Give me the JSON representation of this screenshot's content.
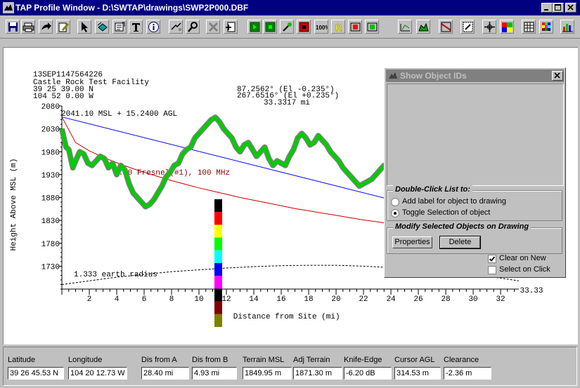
{
  "window": {
    "title": "TAP Profile Window - D:\\SWTAP\\drawings\\SWP2P000.DBF"
  },
  "header": {
    "site_id": "13SEP1147564226",
    "site_name": "Castle Rock Test Facility",
    "site_lat": " 39 25 39.00 N",
    "site_lon": "104 52 0.00 W",
    "az1": "87.2562° (El -0.235°)",
    "az2": "267.6516° (El +0.235°)",
    "distance": "33.3317 mi",
    "antenna_label": "2041.10 MSL + 15.2400 AGL",
    "fresnel_label": "0.50 Fresnel(#1), 100 MHz",
    "earth_label": "1.333 earth radius"
  },
  "chart_data": {
    "type": "line",
    "xlabel": "Distance from Site (mi)",
    "ylabel": "Height Above MSL (m)",
    "xlim": [
      0,
      33.33
    ],
    "ylim": [
      1680,
      2080
    ],
    "x_ticks": [
      "2",
      "4",
      "6",
      "8",
      "10",
      "12",
      "14",
      "16",
      "18",
      "20",
      "22",
      "24",
      "26",
      "28",
      "30",
      "32"
    ],
    "x_end_label": "33.33",
    "y_ticks": [
      "2080",
      "2030",
      "1980",
      "1930",
      "1880",
      "1830",
      "1780",
      "1730"
    ],
    "terrain": {
      "x": [
        0,
        0.3,
        0.5,
        0.8,
        1.0,
        1.3,
        1.6,
        1.9,
        2.2,
        2.5,
        2.8,
        3.1,
        3.4,
        3.7,
        4.0,
        4.3,
        4.6,
        4.9,
        5.2,
        5.5,
        5.8,
        6.1,
        6.4,
        6.7,
        7.0,
        7.3,
        7.6,
        7.9,
        8.2,
        8.5,
        8.8,
        9.1,
        9.4,
        9.7,
        10.0,
        10.3,
        10.6,
        10.9,
        11.2,
        11.5,
        11.8,
        12.1,
        12.4,
        12.7,
        13.0,
        13.3,
        13.6,
        13.9,
        14.2,
        14.5,
        14.8,
        15.1,
        15.4,
        15.7,
        16.0,
        16.3,
        16.6,
        16.9,
        17.2,
        17.5,
        17.8,
        18.1,
        18.4,
        18.7,
        19.0,
        19.3,
        19.6,
        19.9,
        20.2,
        20.5,
        20.8,
        21.1,
        21.4,
        21.7,
        22.0,
        22.3,
        22.6,
        22.9,
        23.2,
        23.5,
        23.8,
        24.1
      ],
      "y": [
        2030,
        1990,
        1985,
        1945,
        1960,
        1980,
        1975,
        1955,
        1950,
        1960,
        1970,
        1965,
        1945,
        1955,
        1930,
        1950,
        1940,
        1910,
        1890,
        1880,
        1870,
        1860,
        1865,
        1875,
        1890,
        1905,
        1925,
        1935,
        1950,
        1955,
        1975,
        1985,
        1990,
        2010,
        2020,
        2030,
        2040,
        2050,
        2055,
        2045,
        2030,
        2020,
        2010,
        1990,
        1980,
        1995,
        2000,
        1985,
        1970,
        1980,
        1990,
        1965,
        1950,
        1960,
        1955,
        1950,
        1970,
        1985,
        2010,
        2020,
        2010,
        1995,
        2000,
        2015,
        2005,
        1995,
        1980,
        1970,
        1960,
        1945,
        1935,
        1925,
        1915,
        1905,
        1910,
        1915,
        1920,
        1930,
        1940,
        1950,
        1945,
        1935
      ]
    },
    "los": {
      "x": [
        0,
        33.33
      ],
      "y": [
        2056,
        1805
      ]
    },
    "fresnel": {
      "x": [
        0,
        1,
        2,
        3,
        4,
        5,
        6,
        7,
        8,
        9,
        10,
        11,
        12,
        13,
        14,
        15,
        16,
        17,
        18,
        19,
        20,
        21,
        22,
        23,
        24,
        25,
        26,
        27,
        28,
        29,
        30,
        31,
        32,
        33
      ],
      "y": [
        2056,
        2000,
        1982,
        1968,
        1956,
        1945,
        1935,
        1926,
        1917,
        1909,
        1901,
        1894,
        1887,
        1880,
        1874,
        1868,
        1862,
        1856,
        1851,
        1846,
        1841,
        1836,
        1831,
        1827,
        1822,
        1818,
        1814,
        1810,
        1807,
        1804,
        1801,
        1798,
        1796,
        1794
      ]
    },
    "earth": {
      "x": [
        0,
        2,
        4,
        6,
        8,
        10,
        12,
        14,
        16,
        18,
        20,
        22,
        24,
        26,
        28,
        30,
        32,
        33.33
      ],
      "y": [
        1690,
        1698,
        1706,
        1712,
        1718,
        1722,
        1726,
        1729,
        1731,
        1732,
        1732,
        1730,
        1727,
        1723,
        1718,
        1712,
        1704,
        1698
      ]
    },
    "colors": {
      "terrain": "#00cc00",
      "terrain_outline": "#808080",
      "los": "#0000ff",
      "fresnel": "#cc0000",
      "earth": "#000000"
    },
    "legend_swatches": [
      "#000000",
      "#ff0000",
      "#ffff00",
      "#00ff00",
      "#00ffff",
      "#0000ff",
      "#ff00ff",
      "#000000",
      "#800000",
      "#808000"
    ]
  },
  "dialog": {
    "title": "Show Object IDs",
    "group1_label": "Double-Click List to:",
    "radio1": "Add label for object to drawing",
    "radio2": "Toggle Selection of  object",
    "group2_label": "Modify Selected Objects on Drawing",
    "properties_btn": "Properties",
    "delete_btn": "Delete",
    "clear_on_new": "Clear on New",
    "select_on_click": "Select on Click"
  },
  "status": [
    {
      "label": "Latitude",
      "value": "39 26 45.53 N"
    },
    {
      "label": "Longitude",
      "value": "104 20 12.73 W"
    },
    {
      "label": "Dis from A",
      "value": "28.40 mi"
    },
    {
      "label": "Dis from B",
      "value": "4.93 mi"
    },
    {
      "label": "Terrain MSL",
      "value": "1849.95 m"
    },
    {
      "label": "Adj Terrain",
      "value": "1871.30 m"
    },
    {
      "label": "Knife-Edge",
      "value": "-6.20 dB"
    },
    {
      "label": "Cursor AGL",
      "value": "314.53 m"
    },
    {
      "label": "Clearance",
      "value": "-2.36 m"
    }
  ],
  "toolbar_icons": [
    "save-icon",
    "print-icon",
    "export-icon",
    "edit-icon",
    "pointer-icon",
    "layers-icon",
    "text-tool-icon",
    "text-icon",
    "info-icon",
    "measure-icon",
    "find-icon",
    "delete-icon",
    "add-icon",
    "green-play-icon",
    "green-stop-icon",
    "magic-wand-icon",
    "red-stop-icon",
    "zoom-100-icon",
    "r-icon",
    "red-film-icon",
    "green-film-icon",
    "ruler-icon",
    "terrain-icon",
    "area-icon",
    "zoom-box-icon",
    "pan-icon",
    "windows-icon",
    "grid-icon",
    "color-grid-icon",
    "chart-icon"
  ]
}
